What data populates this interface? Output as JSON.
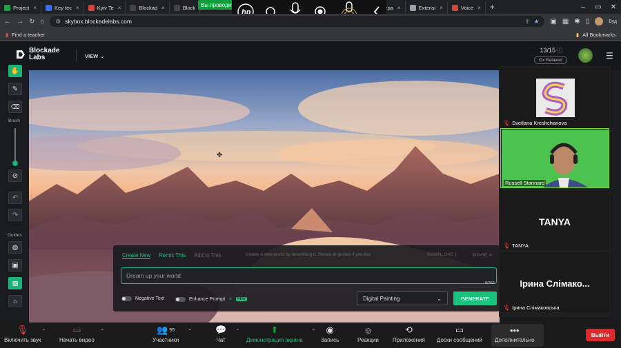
{
  "browser": {
    "tabs": [
      {
        "label": "Project",
        "color": "#1aa34a"
      },
      {
        "label": "Key tec",
        "color": "#3b6df2"
      },
      {
        "label": "Kyiv Te",
        "color": "#d44638"
      },
      {
        "label": "Blockad",
        "color": "#444444"
      },
      {
        "label": "Block",
        "color": "#444444"
      },
      {
        "label": "отра",
        "color": "#444444"
      },
      {
        "label": "Extensi",
        "color": "#9aa0a6"
      },
      {
        "label": "Voice",
        "color": "#d44638"
      }
    ],
    "url": "skybox.blockadelabs.com",
    "bookmark_left": "Find a teacher",
    "bookmark_right": "All Bookmarks",
    "profile_label": "Буд"
  },
  "zoom_share_label": "Вы проводите",
  "app": {
    "logo_line1": "Blockade",
    "logo_line2": "Labs",
    "view_label": "VIEW",
    "credits": "13/15",
    "mode": "Ox Relaxed",
    "toolbar": {
      "brush_label": "Brush",
      "guides_label": "Guides"
    },
    "prompt_panel": {
      "tabs": [
        "Create New",
        "Remix This",
        "Add to This"
      ],
      "hint": "Create a new world by describing it. Sketch in guides if you like.",
      "download_label": "DOWNLOAD",
      "share_label": "SHARE",
      "placeholder": "Dream up your world",
      "char_count": "0/383",
      "negative_text_label": "Negative Text",
      "enhance_prompt_label": "Enhance Prompt",
      "beta_badge": "NEW",
      "style": "Digital Painting",
      "generate_label": "GENERATE"
    }
  },
  "participants": [
    {
      "name": "Svetlana Kreshchanova",
      "display": ""
    },
    {
      "name": "Russell Stannard",
      "display": ""
    },
    {
      "name": "TANYA",
      "display": "TANYA"
    },
    {
      "name": "Ірина Слімаковська",
      "display": "Ірина Слімако..."
    }
  ],
  "zoom_controls": {
    "mute": "Включить звук",
    "video": "Начать видео",
    "participants": "Участники",
    "participants_count": "95",
    "chat": "Чат",
    "share": "Демонстрация экрана",
    "record": "Запись",
    "reactions": "Реакции",
    "apps": "Приложения",
    "whiteboards": "Доски сообщений",
    "more": "Дополнительно",
    "leave": "Выйти"
  },
  "colors": {
    "accent": "#19c37d",
    "leave": "#e02828",
    "share_green": "#0e9f3b"
  }
}
